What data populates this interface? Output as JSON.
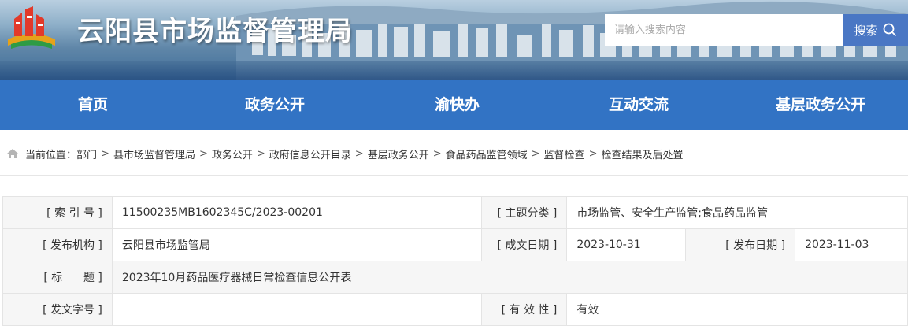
{
  "header": {
    "site_title": "云阳县市场监督管理局",
    "search": {
      "placeholder": "请输入搜索内容",
      "button_label": "搜索"
    }
  },
  "nav": {
    "items": [
      "首页",
      "政务公开",
      "渝快办",
      "互动交流",
      "基层政务公开"
    ]
  },
  "breadcrumb": {
    "prefix": "当前位置：",
    "items": [
      "部门",
      "县市场监督管理局",
      "政务公开",
      "政府信息公开目录",
      "基层政务公开",
      "食品药品监管领域",
      "监督检查",
      "检查结果及后处置"
    ]
  },
  "meta": {
    "index_label": "[ 索 引 号 ]",
    "index_value": "11500235MB1602345C/2023-00201",
    "topic_label": "[ 主题分类 ]",
    "topic_value": "市场监管、安全生产监管;食品药品监管",
    "publisher_label": "[ 发布机构 ]",
    "publisher_value": "云阳县市场监管局",
    "created_label": "[ 成文日期 ]",
    "created_value": "2023-10-31",
    "published_label": "[ 发布日期 ]",
    "published_value": "2023-11-03",
    "title_label": "[ 标      题 ]",
    "title_value": "2023年10月药品医疗器械日常检查信息公开表",
    "docno_label": "[ 发文字号 ]",
    "docno_value": "",
    "validity_label": "[ 有 效 性 ]",
    "validity_value": "有效"
  },
  "colors": {
    "nav_bg": "#3273c4",
    "search_button": "#4a77c4",
    "label_bg": "#f6f6f6"
  },
  "icons": {
    "logo": "emblem-logo",
    "search": "search-icon",
    "home": "home-icon"
  }
}
